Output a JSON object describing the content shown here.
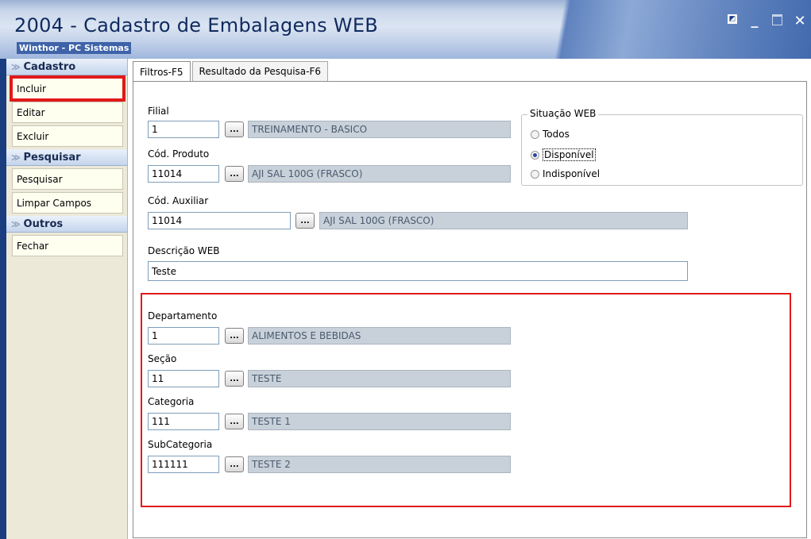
{
  "window": {
    "title": "2004 - Cadastro de Embalagens WEB",
    "subtitle": "Winthor - PC Sistemas",
    "controls": {
      "restore": "◩",
      "minimize": "_",
      "maximize": "",
      "close": "✕"
    }
  },
  "sidebar": {
    "sections": [
      {
        "title": "Cadastro",
        "items": [
          "Incluir",
          "Editar",
          "Excluir"
        ]
      },
      {
        "title": "Pesquisar",
        "items": [
          "Pesquisar",
          "Limpar Campos"
        ]
      },
      {
        "title": "Outros",
        "items": [
          "Fechar"
        ]
      }
    ],
    "chevron": "≫"
  },
  "tabs": [
    {
      "label": "Filtros-F5",
      "active": true
    },
    {
      "label": "Resultado da Pesquisa-F6",
      "active": false
    }
  ],
  "form": {
    "filial": {
      "label": "Filial",
      "value": "1",
      "desc": "TREINAMENTO - BASICO"
    },
    "cod_produto": {
      "label": "Cód. Produto",
      "value": "11014",
      "desc": "AJI SAL 100G (FRASCO)"
    },
    "cod_auxiliar": {
      "label": "Cód. Auxiliar",
      "value": "11014",
      "desc": "AJI SAL 100G (FRASCO)"
    },
    "descricao_web": {
      "label": "Descrição WEB",
      "value": "Teste"
    },
    "departamento": {
      "label": "Departamento",
      "value": "1",
      "desc": "ALIMENTOS E BEBIDAS"
    },
    "secao": {
      "label": "Seção",
      "value": "11",
      "desc": "TESTE"
    },
    "categoria": {
      "label": "Categoria",
      "value": "111",
      "desc": "TESTE 1"
    },
    "subcategoria": {
      "label": "SubCategoria",
      "value": "111111",
      "desc": "TESTE 2"
    },
    "dots_label": "..."
  },
  "situacao_web": {
    "title": "Situação WEB",
    "options": [
      "Todos",
      "Disponível",
      "Indisponível"
    ],
    "selected": "Disponível"
  }
}
